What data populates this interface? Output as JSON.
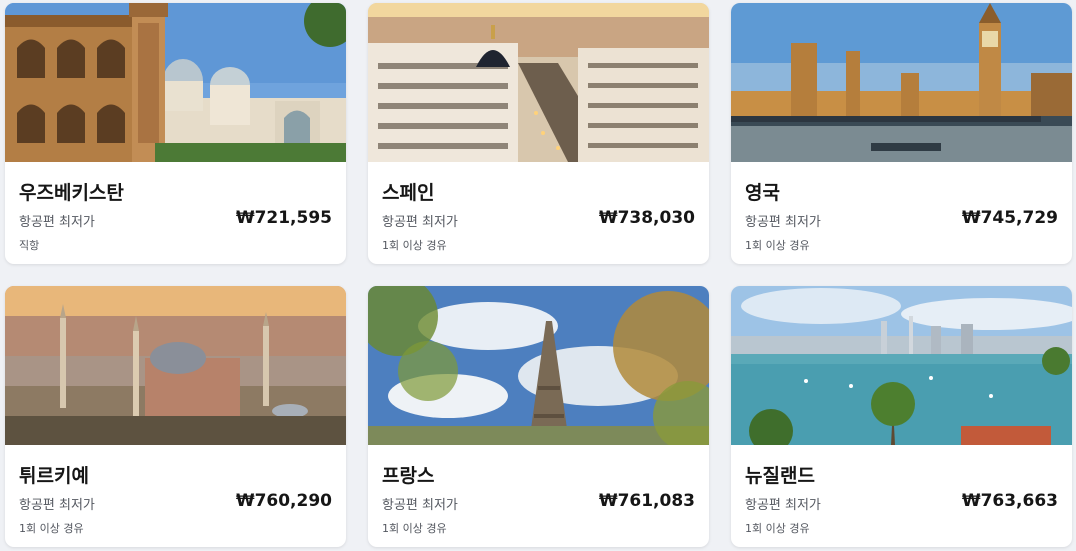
{
  "destinations": [
    {
      "name": "우즈베키스탄",
      "fare_label": "항공편 최저가",
      "price": "₩721,595",
      "stops": "직항",
      "image": "uzbekistan-mosque-photo"
    },
    {
      "name": "스페인",
      "fare_label": "항공편 최저가",
      "price": "₩738,030",
      "stops": "1회 이상 경유",
      "image": "madrid-gran-via-photo"
    },
    {
      "name": "영국",
      "fare_label": "항공편 최저가",
      "price": "₩745,729",
      "stops": "1회 이상 경유",
      "image": "london-big-ben-photo"
    },
    {
      "name": "튀르키예",
      "fare_label": "항공편 최저가",
      "price": "₩760,290",
      "stops": "1회 이상 경유",
      "image": "istanbul-hagia-sophia-photo"
    },
    {
      "name": "프랑스",
      "fare_label": "항공편 최저가",
      "price": "₩761,083",
      "stops": "1회 이상 경유",
      "image": "paris-eiffel-tower-photo"
    },
    {
      "name": "뉴질랜드",
      "fare_label": "항공편 최저가",
      "price": "₩763,663",
      "stops": "1회 이상 경유",
      "image": "auckland-harbour-photo"
    }
  ],
  "colors": {
    "page_background": "#eff1f5",
    "card_background": "#ffffff",
    "text_primary": "#161616",
    "text_secondary": "#545860"
  }
}
